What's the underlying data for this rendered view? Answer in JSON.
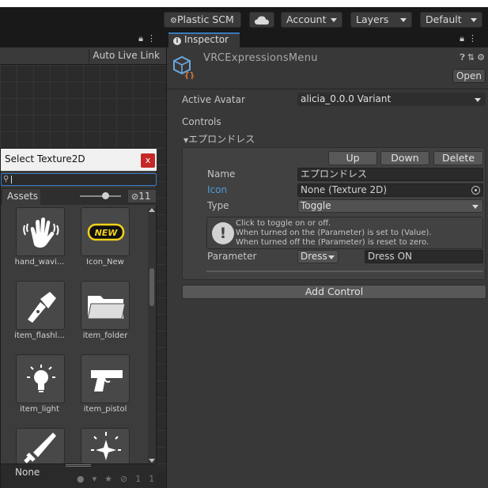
{
  "toolbar": {
    "plastic_label": "Plastic SCM",
    "account_label": "Account",
    "layers_label": "Layers",
    "layout_label": "Default"
  },
  "scene": {
    "auto_live_link": "Auto Live Link"
  },
  "inspector": {
    "tab_label": "Inspector",
    "object_title": "VRCExpressionsMenu",
    "open_button": "Open",
    "active_avatar_label": "Active Avatar",
    "active_avatar_value": "alicia_0.0.0 Variant",
    "controls_label": "Controls",
    "control_foldout": "エプロンドレス",
    "up_button": "Up",
    "down_button": "Down",
    "delete_button": "Delete",
    "name_label": "Name",
    "name_value": "エプロンドレス",
    "icon_label": "Icon",
    "icon_value": "None (Texture 2D)",
    "type_label": "Type",
    "type_value": "Toggle",
    "help_line1": "Click to toggle on or off.",
    "help_line2": "When turned on the (Parameter) is set to (Value).",
    "help_line3": "When turned off the (Parameter) is reset to zero.",
    "parameter_label": "Parameter",
    "parameter_value": "Dress",
    "parameter_name_value": "Dress ON",
    "add_control_button": "Add Control",
    "accent_color": "#4f9bd9"
  },
  "picker": {
    "title": "Select Texture2D",
    "close_glyph": "x",
    "search_value": "",
    "assets_tab": "Assets",
    "count": "11",
    "items": [
      {
        "label": "hand_wavi...",
        "icon": "hand-wave-icon"
      },
      {
        "label": "Icon_New",
        "icon": "new-badge-icon"
      },
      {
        "label": "item_flashl...",
        "icon": "flashlight-icon"
      },
      {
        "label": "item_folder",
        "icon": "folder-icon"
      },
      {
        "label": "item_light",
        "icon": "light-bulb-icon"
      },
      {
        "label": "item_pistol",
        "icon": "pistol-icon"
      },
      {
        "label": "",
        "icon": "sword-icon"
      },
      {
        "label": "",
        "icon": "sparkle-wand-icon"
      }
    ],
    "new_badge_text": "NEW",
    "none_label": "None",
    "footer_count": "11"
  }
}
